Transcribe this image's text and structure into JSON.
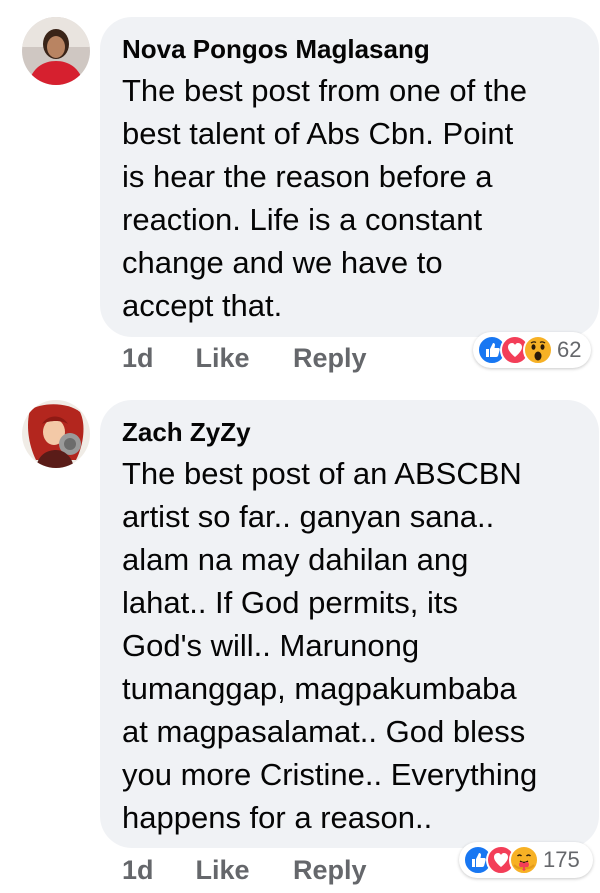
{
  "comments": [
    {
      "author": "Nova Pongos Maglasang",
      "lines": [
        "The best post from one of the",
        "best talent of Abs Cbn. Point",
        "is hear the reason before a",
        "reaction. Life is a constant",
        "change and we have to",
        "accept that."
      ],
      "time": "1d",
      "like_label": "Like",
      "reply_label": "Reply",
      "reactions": [
        "like-reaction-icon",
        "love-reaction-icon",
        "wow-reaction-icon"
      ],
      "reaction_count": "62"
    },
    {
      "author": "Zach ZyZy",
      "lines": [
        "The best post of an ABSCBN",
        "artist so far.. ganyan sana..",
        "alam na may dahilan ang",
        "lahat.. If God permits, its",
        "God's will.. Marunong",
        "tumanggap, magpakumbaba",
        "at magpasalamat.. God bless",
        "you more Cristine.. Everything",
        "happens for a reason.."
      ],
      "time": "1d",
      "like_label": "Like",
      "reply_label": "Reply",
      "reactions": [
        "like-reaction-icon",
        "love-reaction-icon",
        "care-reaction-icon"
      ],
      "reaction_count": "175"
    }
  ],
  "colors": {
    "bubble": "#f0f2f5",
    "meta": "#65676b",
    "like_blue": "#1877f2",
    "love_red": "#f33e58",
    "emoji_yellow": "#f7b125"
  }
}
